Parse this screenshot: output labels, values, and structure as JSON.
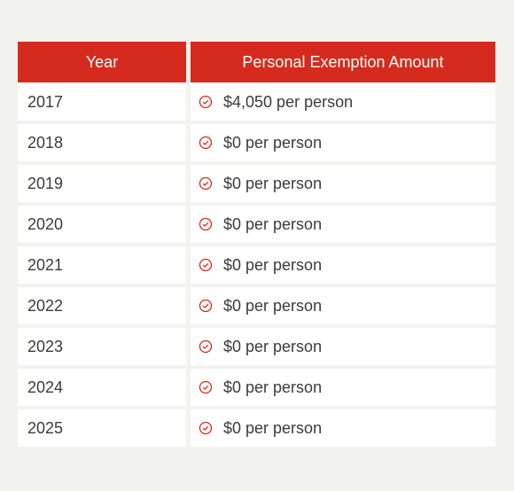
{
  "header": {
    "year": "Year",
    "amount": "Personal Exemption Amount"
  },
  "rows": [
    {
      "year": "2017",
      "amount": "$4,050 per person"
    },
    {
      "year": "2018",
      "amount": "$0 per person"
    },
    {
      "year": "2019",
      "amount": "$0 per person"
    },
    {
      "year": "2020",
      "amount": "$0 per person"
    },
    {
      "year": "2021",
      "amount": "$0 per person"
    },
    {
      "year": "2022",
      "amount": "$0 per person"
    },
    {
      "year": "2023",
      "amount": "$0 per person"
    },
    {
      "year": "2024",
      "amount": "$0 per person"
    },
    {
      "year": "2025",
      "amount": "$0 per person"
    }
  ],
  "icon": "check-circle-icon",
  "colors": {
    "accent": "#d52b1e",
    "background": "#f2f2ee"
  }
}
